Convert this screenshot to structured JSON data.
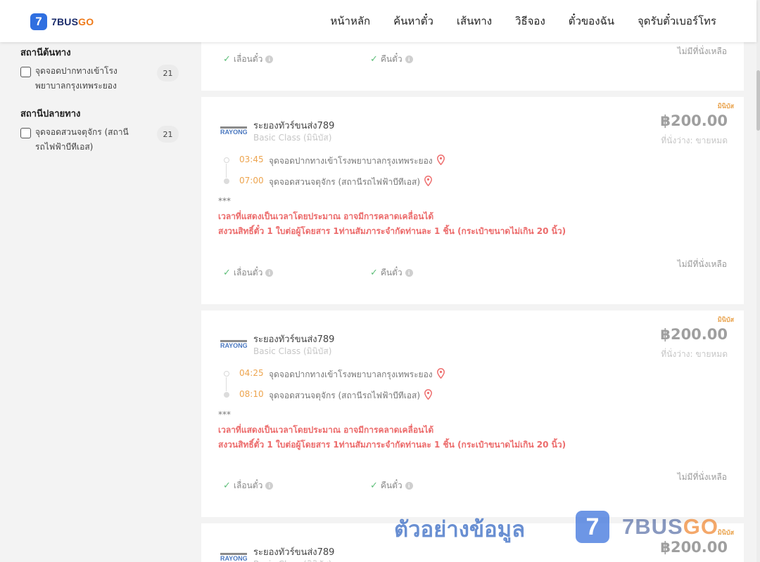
{
  "header": {
    "logo_badge": "7",
    "logo_brand_a": "7BUS",
    "logo_brand_b": "GO",
    "nav": [
      "หน้าหลัก",
      "ค้นหาตั๋ว",
      "เส้นทาง",
      "วิธีจอง",
      "ตั๋วของฉัน",
      "จุดรับตั๋วเบอร์โทร"
    ]
  },
  "sidebar": {
    "origin_title": "สถานีต้นทาง",
    "origin_option": {
      "label": "จุดจอดปากทางเข้าโรงพยาบาลกรุงเทพระยอง",
      "count": "21",
      "checked": false
    },
    "dest_title": "สถานีปลายทาง",
    "dest_option": {
      "label": "จุดจอดสวนจตุจักร (สถานีรถไฟฟ้าบีทีเอส)",
      "count": "21",
      "checked": false
    }
  },
  "common": {
    "feature_reschedule": "เลื่อนตั๋ว",
    "feature_refund": "คืนตั๋ว",
    "no_seat": "ไม่มีที่นั่งเหลือ",
    "stars": "***",
    "notice_line1": "เวลาที่แสดงเป็นเวลาโดยประมาณ อาจมีการคลาดเคลื่อนได้",
    "notice_line2": "สงวนสิทธิ์ตั๋ว 1 ใบต่อผู้โดยสาร 1ท่านสัมภาระจำกัดท่านละ 1 ชิ้น (กระเป๋าขนาดไม่เกิน 20 นิ้ว)"
  },
  "trips": [
    {
      "badge": "มินิบัส",
      "operator": "ระยองทัวร์ขนส่ง789",
      "class": "Basic Class (มินิบัส)",
      "price": "฿200.00",
      "availability": "ที่นั่งว่าง: ขายหมด",
      "depart_time": "03:45",
      "depart_stop": "จุดจอดปากทางเข้าโรงพยาบาลกรุงเทพระยอง",
      "arrive_time": "07:00",
      "arrive_stop": "จุดจอดสวนจตุจักร (สถานีรถไฟฟ้าบีทีเอส)"
    },
    {
      "badge": "มินิบัส",
      "operator": "ระยองทัวร์ขนส่ง789",
      "class": "Basic Class (มินิบัส)",
      "price": "฿200.00",
      "availability": "ที่นั่งว่าง: ขายหมด",
      "depart_time": "04:25",
      "depart_stop": "จุดจอดปากทางเข้าโรงพยาบาลกรุงเทพระยอง",
      "arrive_time": "08:10",
      "arrive_stop": "จุดจอดสวนจตุจักร (สถานีรถไฟฟ้าบีทีเอส)"
    },
    {
      "badge": "มินิบัส",
      "operator": "ระยองทัวร์ขนส่ง789",
      "class": "Basic Class (มินิบัส)",
      "price": "฿200.00"
    }
  ],
  "watermark": {
    "text": "ตัวอย่างข้อมูล",
    "badge": "7",
    "brand_a": "7BUS",
    "brand_b": "GO"
  },
  "colors": {
    "accent_blue": "#2f6fe0",
    "time_orange": "#eda44e",
    "notice_red": "#ec6b6b",
    "check_green": "#5fbf7a"
  }
}
